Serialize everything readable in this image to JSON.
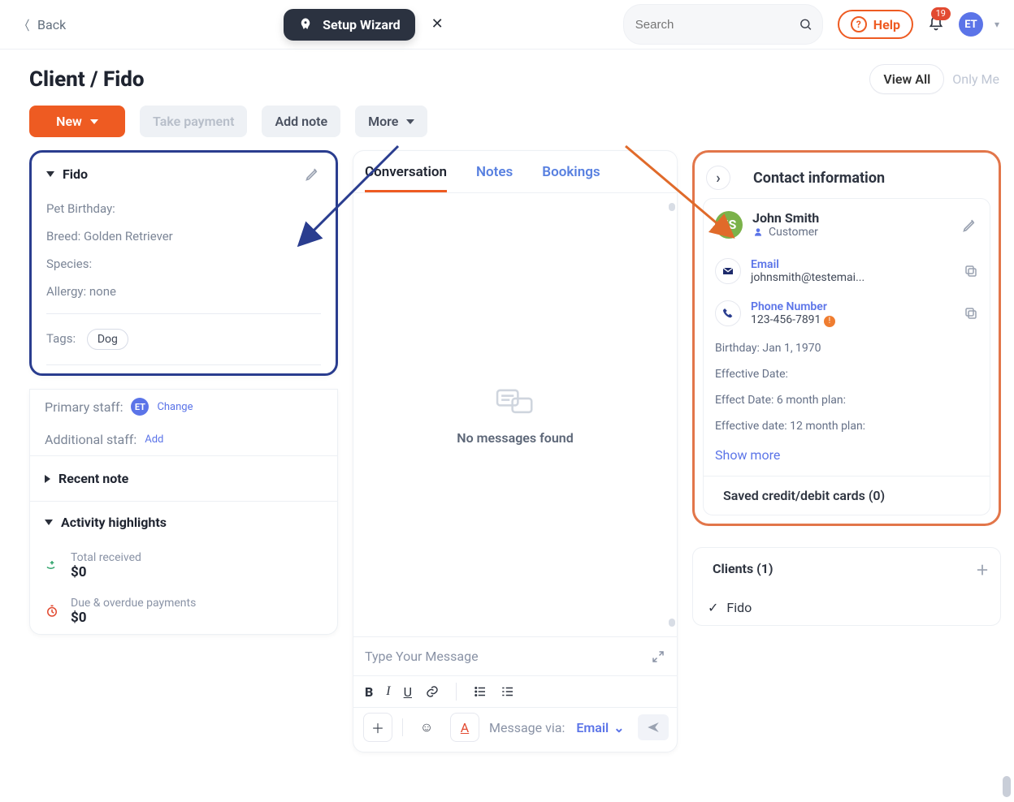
{
  "top": {
    "back": "Back",
    "wizard": "Setup Wizard",
    "search_placeholder": "Search",
    "help": "Help",
    "notif_count": "19",
    "avatar": "ET"
  },
  "header": {
    "title": "Client / Fido",
    "view_all": "View All",
    "only_me": "Only Me"
  },
  "toolbar": {
    "new": "New",
    "take_payment": "Take payment",
    "add_note": "Add note",
    "more": "More"
  },
  "pet": {
    "name": "Fido",
    "fields": {
      "birthday_label": "Pet Birthday:",
      "breed_label": "Breed:",
      "breed_value": "Golden Retriever",
      "species_label": "Species:",
      "allergy_label": "Allergy:",
      "allergy_value": "none",
      "tags_label": "Tags:",
      "tag": "Dog"
    }
  },
  "staff": {
    "primary_label": "Primary staff:",
    "primary_avatar": "ET",
    "primary_action": "Change",
    "additional_label": "Additional staff:",
    "additional_action": "Add"
  },
  "recent_note": "Recent note",
  "activity": {
    "title": "Activity highlights",
    "total_received_label": "Total received",
    "total_received_value": "$0",
    "due_label": "Due & overdue payments",
    "due_value": "$0"
  },
  "middle": {
    "tabs": {
      "conversation": "Conversation",
      "notes": "Notes",
      "bookings": "Bookings"
    },
    "empty": "No messages found",
    "compose_placeholder": "Type Your Message",
    "message_via_label": "Message via:",
    "message_via_value": "Email"
  },
  "contact": {
    "section_title": "Contact information",
    "avatar": "JS",
    "name": "John Smith",
    "role": "Customer",
    "email_label": "Email",
    "email_value": "johnsmith@testemai...",
    "phone_label": "Phone Number",
    "phone_value": "123-456-7891",
    "birthday_label": "Birthday:",
    "birthday_value": "Jan 1, 1970",
    "effective_date_label": "Effective Date:",
    "effect6_label": "Effect Date: 6 month plan:",
    "effect12_label": "Effective date: 12 month plan:",
    "show_more": "Show more",
    "saved_cards": "Saved credit/debit cards (0)"
  },
  "clients": {
    "title": "Clients (1)",
    "item": "Fido"
  }
}
